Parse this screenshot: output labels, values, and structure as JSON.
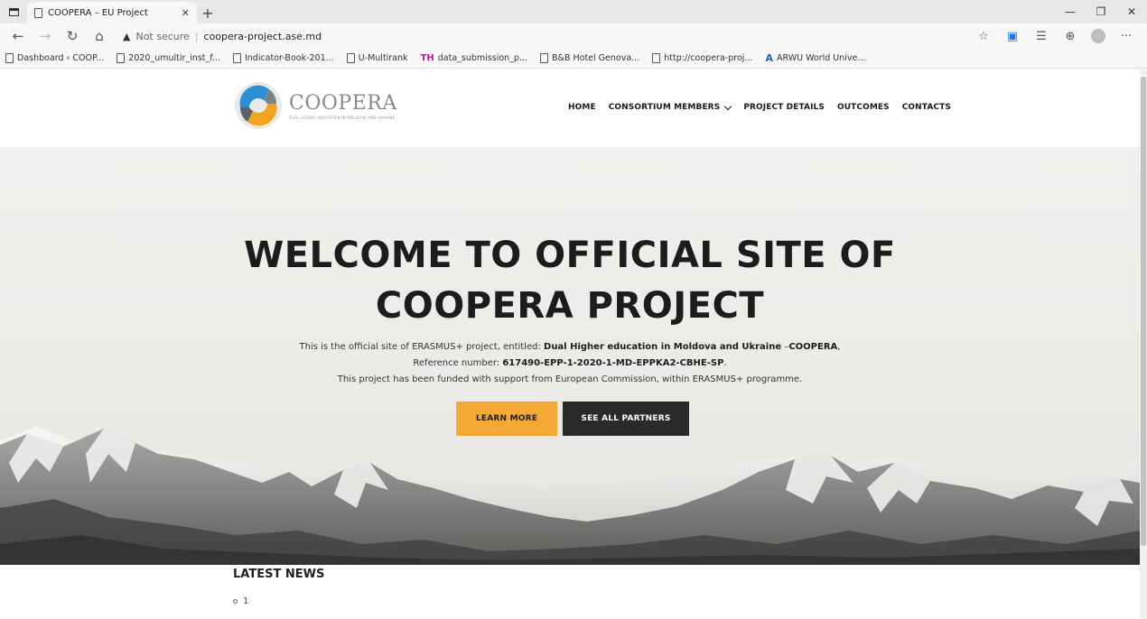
{
  "browser": {
    "tab_title": "COOPERA – EU Project",
    "security_label": "Not secure",
    "url": "coopera-project.ase.md",
    "bookmarks": [
      "Dashboard ‹ COOP...",
      "2020_umultir_inst_f...",
      "Indicator-Book-201...",
      "U-Multirank",
      "data_submission_p...",
      "B&B Hotel Genova...",
      "http://coopera-proj...",
      "ARWU World Unive..."
    ]
  },
  "site": {
    "logo_text": "COOPERA",
    "logo_tagline": "DUAL HIGHER EDUCATION IN MOLDOVA AND UKRAINE",
    "nav": {
      "home": "HOME",
      "members": "CONSORTIUM MEMBERS",
      "details": "PROJECT DETAILS",
      "outcomes": "OUTCOMES",
      "contacts": "CONTACTS"
    }
  },
  "hero": {
    "title_line1": "WELCOME TO OFFICIAL SITE OF",
    "title_line2": "COOPERA PROJECT",
    "line1_prefix": "This is the official site of ERASMUS+ project, entitled: ",
    "line1_bold": "Dual Higher education in Moldova and Ukraine",
    "line1_mid": " –",
    "line1_bold2": "COOPERA",
    "line1_suffix": ",",
    "line2_prefix": "Reference number:  ",
    "line2_bold": "617490-EPP-1-2020-1-MD-EPPKA2-CBHE-SP",
    "line2_suffix": ".",
    "line3": "This project has been funded with support from European Commission, within ERASMUS+ programme.",
    "learn_more": "LEARN MORE",
    "see_partners": "SEE ALL PARTNERS"
  },
  "news": {
    "title": "LATEST NEWS",
    "items": [
      "1"
    ]
  },
  "colors": {
    "accent": "#f4a934",
    "dark_button": "#2a2a2a",
    "logo_blue": "#2c8fd1",
    "logo_orange": "#f2a51c"
  }
}
